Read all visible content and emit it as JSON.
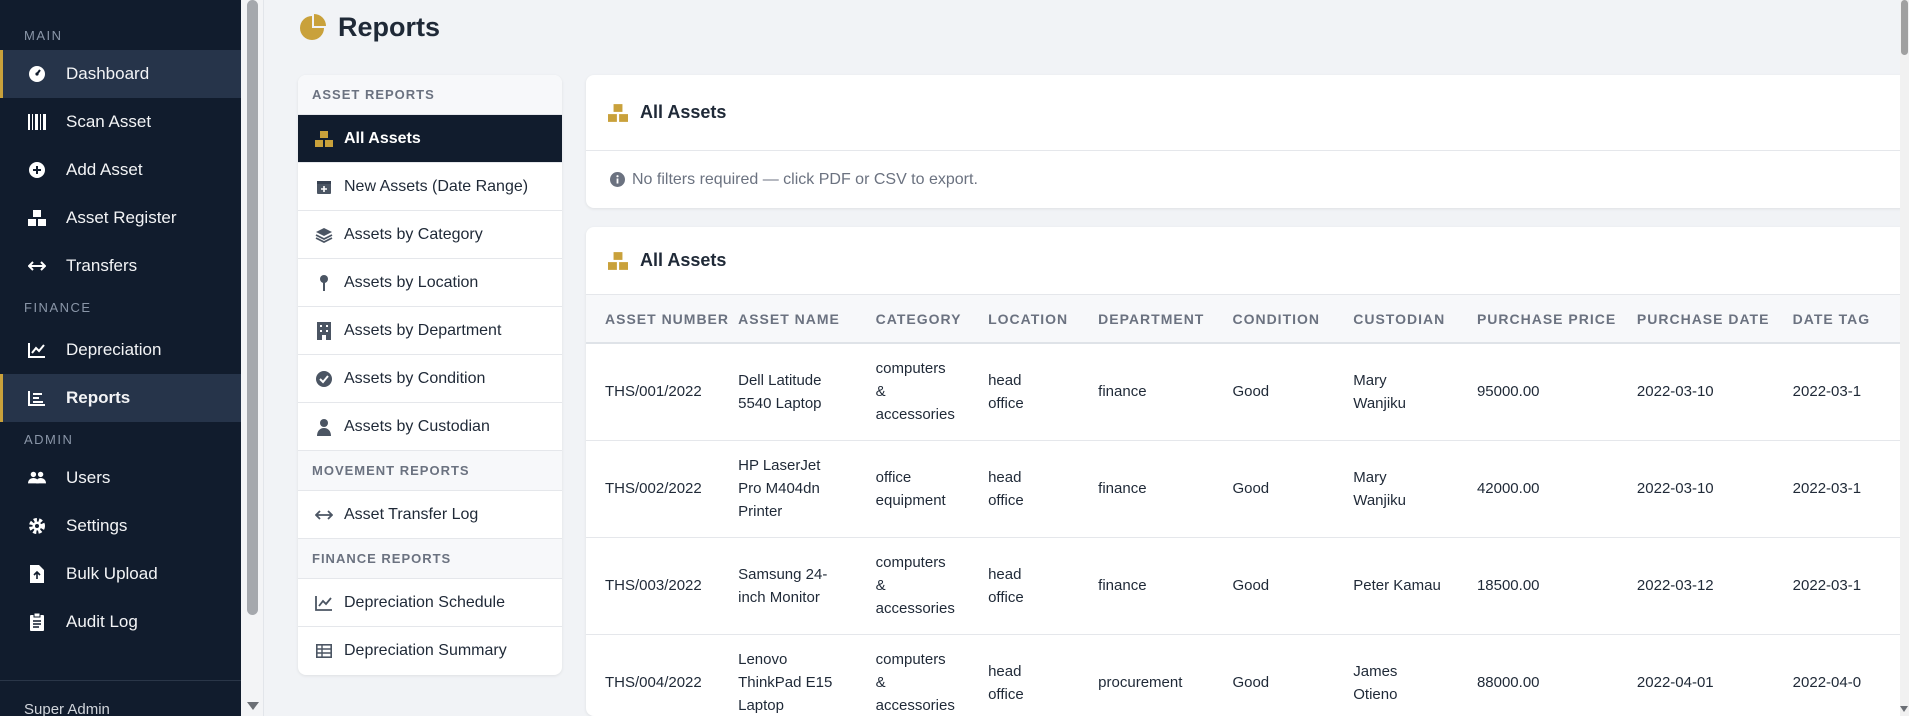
{
  "colors": {
    "accent": "#c9a13b",
    "sidebar_bg": "#111c2d",
    "active_bg": "#26344a"
  },
  "sidebar": {
    "sections": [
      {
        "label": "MAIN",
        "items": [
          {
            "label": "Dashboard",
            "icon": "dashboard-gauge-icon",
            "active": true
          },
          {
            "label": "Scan Asset",
            "icon": "barcode-icon"
          },
          {
            "label": "Add Asset",
            "icon": "plus-circle-icon"
          },
          {
            "label": "Asset Register",
            "icon": "boxes-icon"
          },
          {
            "label": "Transfers",
            "icon": "arrows-horizontal-icon"
          }
        ]
      },
      {
        "label": "FINANCE",
        "items": [
          {
            "label": "Depreciation",
            "icon": "line-chart-icon"
          },
          {
            "label": "Reports",
            "icon": "bar-list-icon",
            "active": true
          }
        ]
      },
      {
        "label": "ADMIN",
        "items": [
          {
            "label": "Users",
            "icon": "users-icon"
          },
          {
            "label": "Settings",
            "icon": "gear-icon"
          },
          {
            "label": "Bulk Upload",
            "icon": "file-upload-icon"
          },
          {
            "label": "Audit Log",
            "icon": "clipboard-icon"
          }
        ]
      }
    ],
    "user_label": "Super Admin"
  },
  "page": {
    "title": "Reports",
    "icon": "pie-chart-icon"
  },
  "report_menu": {
    "sections": [
      {
        "label": "ASSET REPORTS",
        "items": [
          {
            "label": "All Assets",
            "icon": "boxes-icon",
            "active": true
          },
          {
            "label": "New Assets (Date Range)",
            "icon": "calendar-plus-icon"
          },
          {
            "label": "Assets by Category",
            "icon": "layers-icon"
          },
          {
            "label": "Assets by Location",
            "icon": "map-pin-icon"
          },
          {
            "label": "Assets by Department",
            "icon": "building-icon"
          },
          {
            "label": "Assets by Condition",
            "icon": "check-circle-icon"
          },
          {
            "label": "Assets by Custodian",
            "icon": "user-icon"
          }
        ]
      },
      {
        "label": "MOVEMENT REPORTS",
        "items": [
          {
            "label": "Asset Transfer Log",
            "icon": "arrows-horizontal-icon"
          }
        ]
      },
      {
        "label": "FINANCE REPORTS",
        "items": [
          {
            "label": "Depreciation Schedule",
            "icon": "line-chart-icon"
          },
          {
            "label": "Depreciation Summary",
            "icon": "table-icon"
          }
        ]
      }
    ]
  },
  "filter_card": {
    "title": "All Assets",
    "note": "No filters required — click PDF or CSV to export."
  },
  "table_card": {
    "title": "All Assets",
    "columns": [
      "ASSET NUMBER",
      "ASSET NAME",
      "CATEGORY",
      "LOCATION",
      "DEPARTMENT",
      "CONDITION",
      "CUSTODIAN",
      "PURCHASE PRICE",
      "PURCHASE DATE",
      "DATE TAG"
    ],
    "rows": [
      [
        "THS/001/2022",
        "Dell Latitude 5540 Laptop",
        "computers & accessories",
        "head office",
        "finance",
        "Good",
        "Mary Wanjiku",
        "95000.00",
        "2022-03-10",
        "2022-03-1"
      ],
      [
        "THS/002/2022",
        "HP LaserJet Pro M404dn Printer",
        "office equipment",
        "head office",
        "finance",
        "Good",
        "Mary Wanjiku",
        "42000.00",
        "2022-03-10",
        "2022-03-1"
      ],
      [
        "THS/003/2022",
        "Samsung 24-inch Monitor",
        "computers & accessories",
        "head office",
        "finance",
        "Good",
        "Peter Kamau",
        "18500.00",
        "2022-03-12",
        "2022-03-1"
      ],
      [
        "THS/004/2022",
        "Lenovo ThinkPad E15 Laptop",
        "computers & accessories",
        "head office",
        "procurement",
        "Good",
        "James Otieno",
        "88000.00",
        "2022-04-01",
        "2022-04-0"
      ]
    ]
  }
}
